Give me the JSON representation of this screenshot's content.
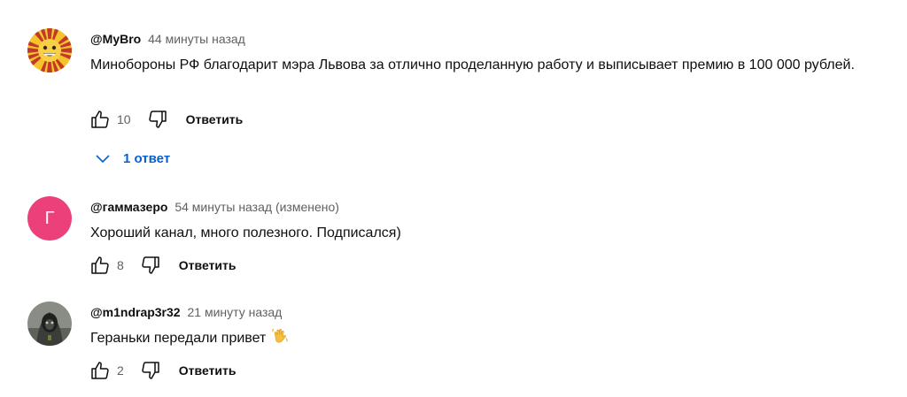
{
  "comments": [
    {
      "author": "@MyBro",
      "time": "44 минуты назад",
      "text": "Минобороны РФ благодарит мэра Львова за отлично проделанную работу и выписывает премию в 100 000 рублей.",
      "likes": "10",
      "reply_label": "Ответить",
      "avatar_icon": "sun-face-avatar",
      "replies_label": "1 ответ"
    },
    {
      "author": "@гаммазеро",
      "time": "54 минуты назад (изменено)",
      "text": "Хороший канал, много полезного. Подписался)",
      "likes": "8",
      "reply_label": "Ответить",
      "avatar_letter": "Г",
      "avatar_color": "#ec407a"
    },
    {
      "author": "@m1ndrap3r32",
      "time": "21 минуту назад",
      "text": "Гераньки передали привет",
      "emoji_icon": "waving-hand-icon",
      "likes": "2",
      "reply_label": "Ответить",
      "avatar_icon": "hooded-figure-avatar"
    }
  ],
  "colors": {
    "link": "#065fd4",
    "secondary_text": "#606060",
    "primary_text": "#0f0f0f"
  }
}
